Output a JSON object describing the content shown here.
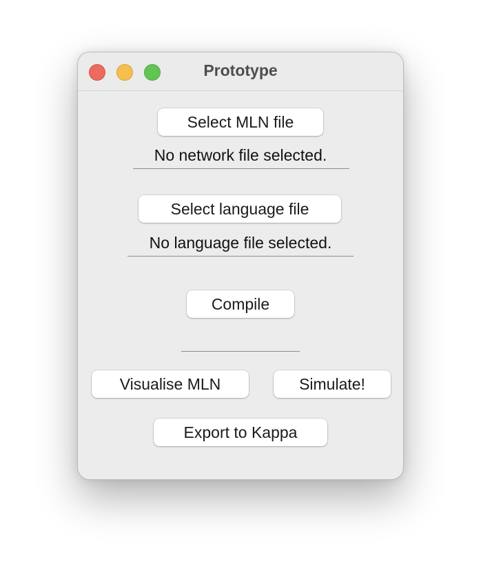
{
  "window": {
    "title": "Prototype"
  },
  "network": {
    "select_button": "Select MLN file",
    "status": "No network file selected."
  },
  "language": {
    "select_button": "Select language file",
    "status": "No language file selected."
  },
  "actions": {
    "compile": "Compile",
    "compile_status": "",
    "visualise": "Visualise MLN",
    "simulate": "Simulate!",
    "export": "Export to Kappa"
  },
  "colors": {
    "close": "#ec6a5e",
    "minimize": "#f4bf4f",
    "zoom": "#61c554"
  }
}
